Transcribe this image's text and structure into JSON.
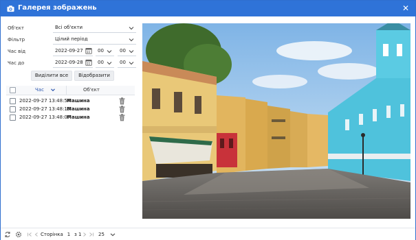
{
  "window": {
    "title": "Галерея зображень",
    "close_glyph": "✕",
    "accent_color": "#2f73d8",
    "title_icon": "camera-icon"
  },
  "filters": {
    "object_label": "Об'єкт",
    "object_value": "Всі об'єкти",
    "filter_label": "Фільтр",
    "filter_value": "Цілий період",
    "time_from_label": "Час від",
    "time_from_date": "2022-09-27",
    "time_from_hour": "00",
    "time_from_minute": "00",
    "time_to_label": "Час до",
    "time_to_date": "2022-09-28",
    "time_to_hour": "00",
    "time_to_minute": "00"
  },
  "actions": {
    "select_all": "Виділити все",
    "show": "Відобразити"
  },
  "grid": {
    "col_time": "Час",
    "col_object": "Об'єкт",
    "rows": [
      {
        "time": "2022-09-27 13:48:54",
        "object": "Машина"
      },
      {
        "time": "2022-09-27 13:48:15",
        "object": "Машина"
      },
      {
        "time": "2022-09-27 13:48:07",
        "object": "Машина"
      }
    ]
  },
  "paging": {
    "page_label": "Сторінка",
    "page_value": "1",
    "of_label": "з 1",
    "page_size": "25"
  }
}
